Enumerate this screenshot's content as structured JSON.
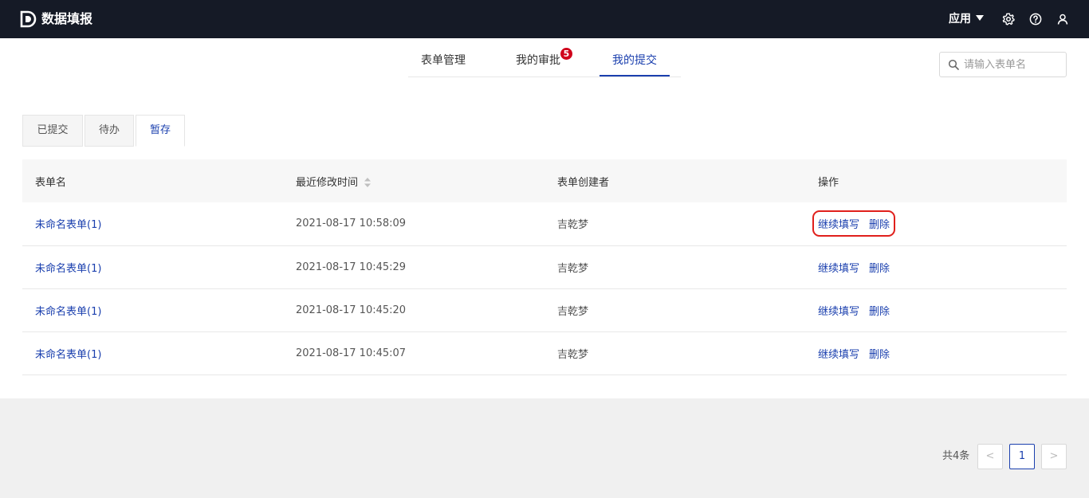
{
  "header": {
    "app_title": "数据填报",
    "apps_menu_label": "应用",
    "icons": [
      "logo-icon",
      "gear-icon",
      "help-icon",
      "user-icon"
    ]
  },
  "nav": {
    "tabs": [
      {
        "label": "表单管理"
      },
      {
        "label": "我的审批",
        "badge": "5"
      },
      {
        "label": "我的提交"
      }
    ],
    "active_tab": "我的提交",
    "search_placeholder": "请输入表单名"
  },
  "subtabs": {
    "items": [
      {
        "label": "已提交"
      },
      {
        "label": "待办"
      },
      {
        "label": "暂存"
      }
    ],
    "active": "暂存"
  },
  "table": {
    "columns": [
      "表单名",
      "最近修改时间",
      "表单创建者",
      "操作"
    ],
    "rows": [
      {
        "name": "未命名表单(1)",
        "modified": "2021-08-17 10:58:09",
        "creator": "吉乾梦",
        "op_continue": "继续填写",
        "op_delete": "删除"
      },
      {
        "name": "未命名表单(1)",
        "modified": "2021-08-17 10:45:29",
        "creator": "吉乾梦",
        "op_continue": "继续填写",
        "op_delete": "删除"
      },
      {
        "name": "未命名表单(1)",
        "modified": "2021-08-17 10:45:20",
        "creator": "吉乾梦",
        "op_continue": "继续填写",
        "op_delete": "删除"
      },
      {
        "name": "未命名表单(1)",
        "modified": "2021-08-17 10:45:07",
        "creator": "吉乾梦",
        "op_continue": "继续填写",
        "op_delete": "删除"
      }
    ]
  },
  "pagination": {
    "total_label": "共4条",
    "current_page": "1",
    "prev_label": "<",
    "next_label": ">"
  },
  "colors": {
    "topbar": "#151a26",
    "accent": "#1a3fae",
    "badge": "#d0021b",
    "highlight": "#e0201c"
  }
}
